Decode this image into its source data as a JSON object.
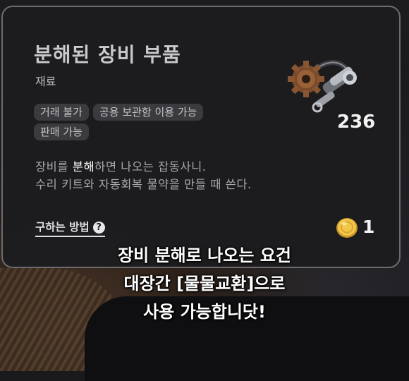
{
  "item": {
    "name": "분해된 장비 부품",
    "category": "재료",
    "tags": [
      "거래 불가",
      "공용 보관함 이용 가능",
      "판매 가능"
    ],
    "description_line1_before": "장비를 ",
    "description_line1_highlight": "분해",
    "description_line1_after": "하면 나오는 잡동사니.",
    "description_line2": "수리 키트와 자동회복 물약을 만들 때 쓴다.",
    "count": "236",
    "how_to_obtain": "구하는 방법",
    "help_icon": "?",
    "price": "1",
    "icon": "gear-and-tools-icon"
  },
  "caption": {
    "line1": "장비 분해로 나오는 요건",
    "line2": "대장간 [물물교환]으로",
    "line3": "사용 가능합니닷!"
  }
}
